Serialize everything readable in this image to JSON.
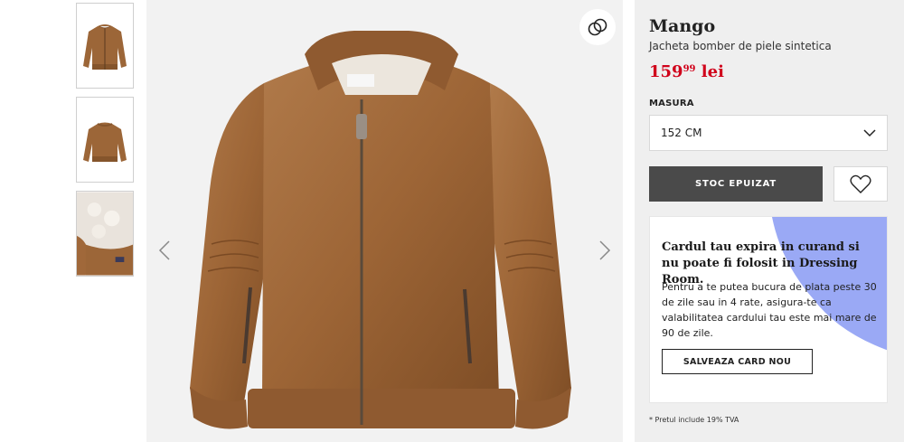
{
  "gallery": {
    "thumbnails": [
      {
        "icon": "jacket-front-thumbnail"
      },
      {
        "icon": "jacket-back-thumbnail"
      },
      {
        "icon": "jacket-lining-detail-thumbnail"
      }
    ],
    "prev_icon": "chevron-left-icon",
    "next_icon": "chevron-right-icon",
    "compare_icon": "compare-circles-icon",
    "main_image": "brown-leather-bomber-jacket"
  },
  "product": {
    "brand": "Mango",
    "name": "Jacheta bomber de piele sintetica",
    "price_int": "159",
    "price_dec": "99",
    "currency": "lei",
    "price_color": "#d0021b"
  },
  "size": {
    "label": "MASURA",
    "selected": "152 CM",
    "icon": "chevron-down-icon"
  },
  "actions": {
    "stock_label": "STOC EPUIZAT",
    "wishlist_icon": "heart-icon"
  },
  "card_notice": {
    "title": "Cardul tau expira in curand si nu poate fi folosit in Dressing Room.",
    "text": "Pentru a te putea bucura de plata peste 30 de zile sau in 4 rate, asigura-te ca valabilitatea cardului tau este mai mare de 90 de zile.",
    "button": "SALVEAZA CARD NOU",
    "accent": "#9aa9f5"
  },
  "footer": {
    "vat_note": "*  Pretul include 19% TVA"
  }
}
